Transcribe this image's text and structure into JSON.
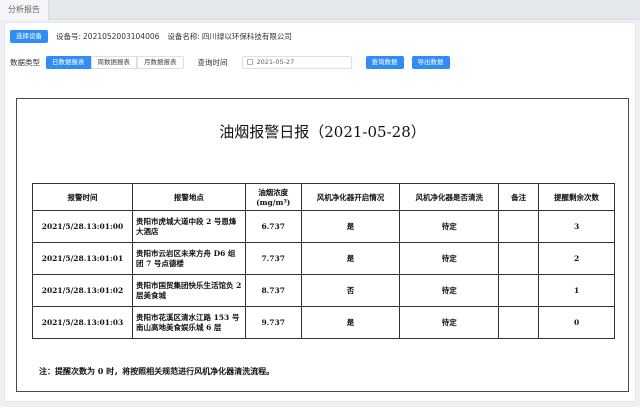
{
  "tab": {
    "label": "分析报告"
  },
  "toolbar": {
    "select_device_label": "选择设备",
    "device_no_label": "设备号:",
    "device_no": "2021052003104006",
    "device_name_label": "设备名称:",
    "device_name": "四川绿以环保科技有限公司"
  },
  "filters": {
    "data_type_label": "数据类型",
    "report_types": [
      "日数据报表",
      "周数据报表",
      "月数据报表"
    ],
    "active_report_index": 0,
    "query_time_label": "查询时间",
    "date_value": "2021-05-27",
    "query_button": "查询数据",
    "export_button": "导出数据"
  },
  "report": {
    "title": "油烟报警日报（2021-05-28）",
    "headers": [
      "报警时间",
      "报警地点",
      "油烟浓度(mg/m³)",
      "风机净化器开启情况",
      "风机净化器是否清洗",
      "备注",
      "提醒剩余次数"
    ],
    "rows": [
      {
        "time": "2021/5/28.13:01:00",
        "location": "贵阳市虎城大道中段 2 号恩烽大酒店",
        "concentration": "6.737",
        "fan_status": "是",
        "cleaned": "待定",
        "remark": "",
        "remaining": "3"
      },
      {
        "time": "2021/5/28.13:01:01",
        "location": "贵阳市云岩区未来方舟 D6 组团 7 号点德楼",
        "concentration": "7.737",
        "fan_status": "是",
        "cleaned": "待定",
        "remark": "",
        "remaining": "2"
      },
      {
        "time": "2021/5/28.13:01:02",
        "location": "贵阳市国贸集团快乐生活馆负 2 层美食城",
        "concentration": "8.737",
        "fan_status": "否",
        "cleaned": "待定",
        "remark": "",
        "remaining": "1"
      },
      {
        "time": "2021/5/28.13:01:03",
        "location": "贵阳市花溪区清水江路 153 号南山高地美食娱乐城 6 层",
        "concentration": "9.737",
        "fan_status": "是",
        "cleaned": "待定",
        "remark": "",
        "remaining": "0"
      }
    ],
    "note": "注：提醒次数为 0 时，将按照相关规范进行风机净化器清洗流程。"
  }
}
